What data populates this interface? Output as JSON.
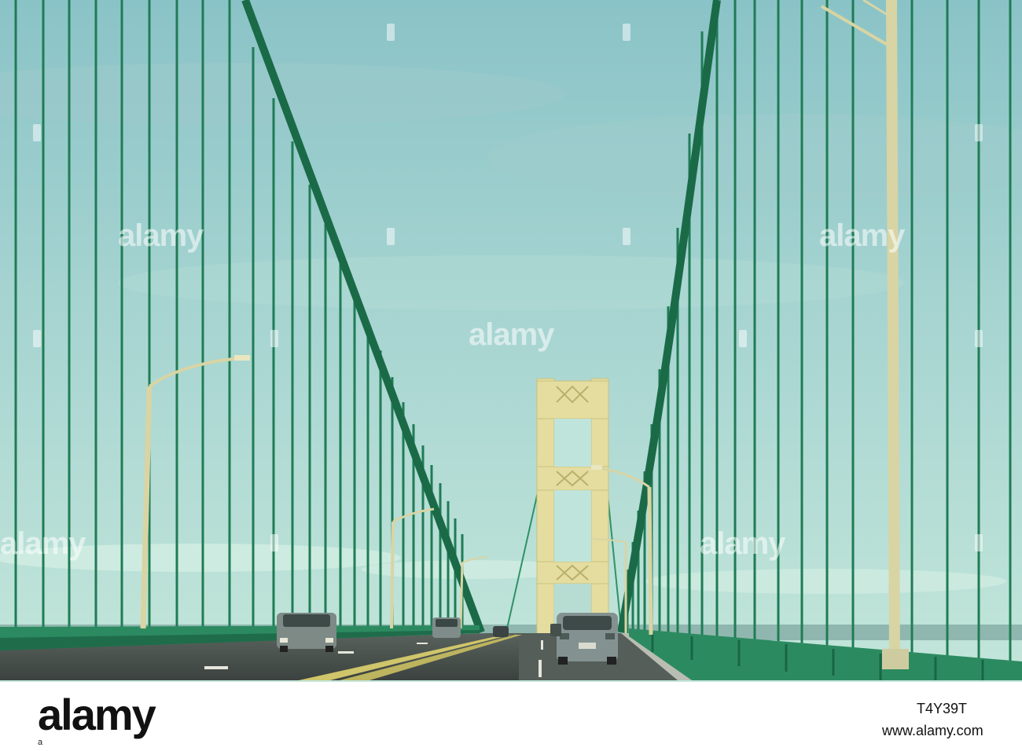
{
  "photo": {
    "subject": "suspension-bridge-roadway",
    "colors": {
      "sky_top": "#8fc6c9",
      "sky_bottom": "#b9e2d9",
      "cable": "#1d7a52",
      "tower": "#e3dc9c",
      "road": "#4c5550",
      "rail": "#2d8b62"
    }
  },
  "watermarks": {
    "text": "alamy"
  },
  "footer": {
    "logo": "alamy",
    "logo_small": "a",
    "image_id": "T4Y39T",
    "url": "www.alamy.com"
  }
}
